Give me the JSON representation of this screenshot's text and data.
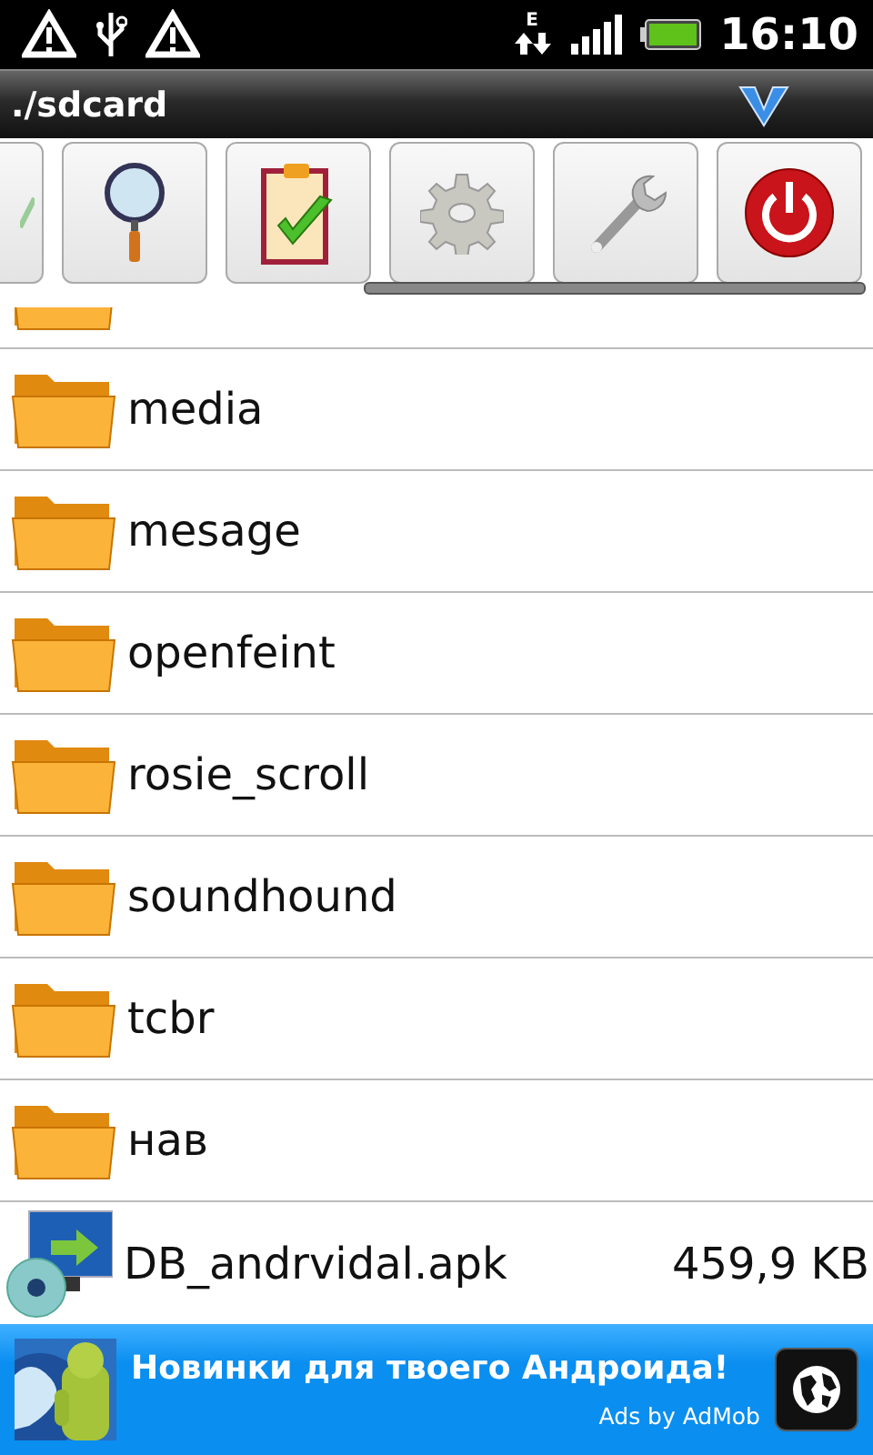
{
  "status_bar": {
    "network": "E",
    "time": "16:10"
  },
  "title_bar": {
    "path": "./sdcard"
  },
  "toolbar": [
    {
      "kind": "partial"
    },
    {
      "kind": "search"
    },
    {
      "kind": "clipboard"
    },
    {
      "kind": "settings"
    },
    {
      "kind": "tools"
    },
    {
      "kind": "power"
    }
  ],
  "files": [
    {
      "kind": "folder-cut"
    },
    {
      "kind": "folder",
      "name": "media"
    },
    {
      "kind": "folder",
      "name": "mesage"
    },
    {
      "kind": "folder",
      "name": "openfeint"
    },
    {
      "kind": "folder",
      "name": "rosie_scroll"
    },
    {
      "kind": "folder",
      "name": "soundhound"
    },
    {
      "kind": "folder",
      "name": "tcbr"
    },
    {
      "kind": "folder",
      "name": "нав"
    },
    {
      "kind": "apk",
      "name": "DB_andrvidal.apk",
      "size": "459,9 KB"
    }
  ],
  "ad": {
    "text": "Новинки для твоего Андроида!",
    "footer": "Ads by AdMob"
  }
}
